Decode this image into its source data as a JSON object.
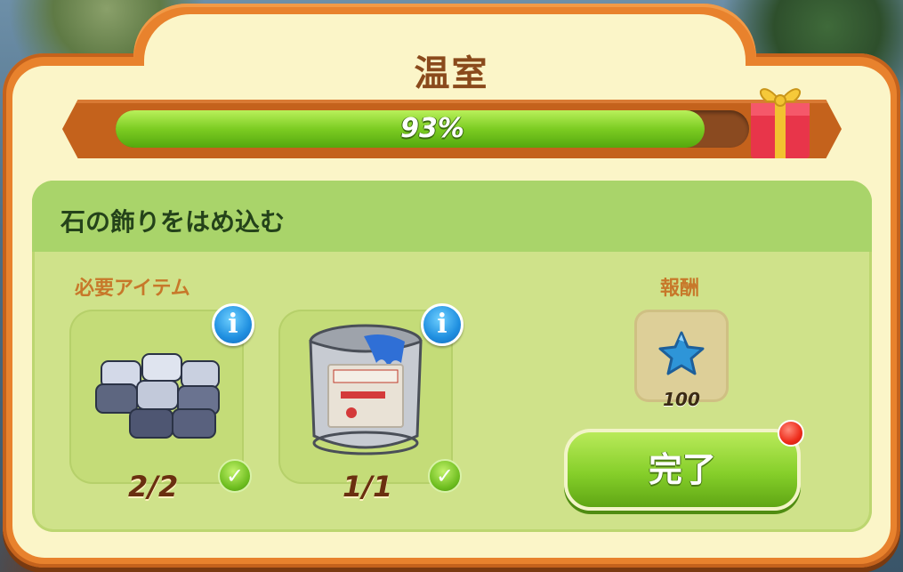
{
  "window": {
    "title": "温室"
  },
  "progress": {
    "percent_label": "93%",
    "value": 0.93
  },
  "task": {
    "title": "石の飾りをはめ込む"
  },
  "required": {
    "label": "必要アイテム",
    "items": [
      {
        "name": "stone-tiles",
        "count": "2/2",
        "complete": true
      },
      {
        "name": "paint-can",
        "count": "1/1",
        "complete": true
      }
    ],
    "info_icon": "i",
    "check_icon": "✓"
  },
  "reward": {
    "label": "報酬",
    "value": "100",
    "icon": "blue-star-icon"
  },
  "actions": {
    "complete_label": "完了"
  },
  "colors": {
    "frame": "#e8822d",
    "panel": "#fbf5c8",
    "progress_fill": "#7ccc22",
    "button": "#86cf2a",
    "notification": "#ee2b1a"
  }
}
